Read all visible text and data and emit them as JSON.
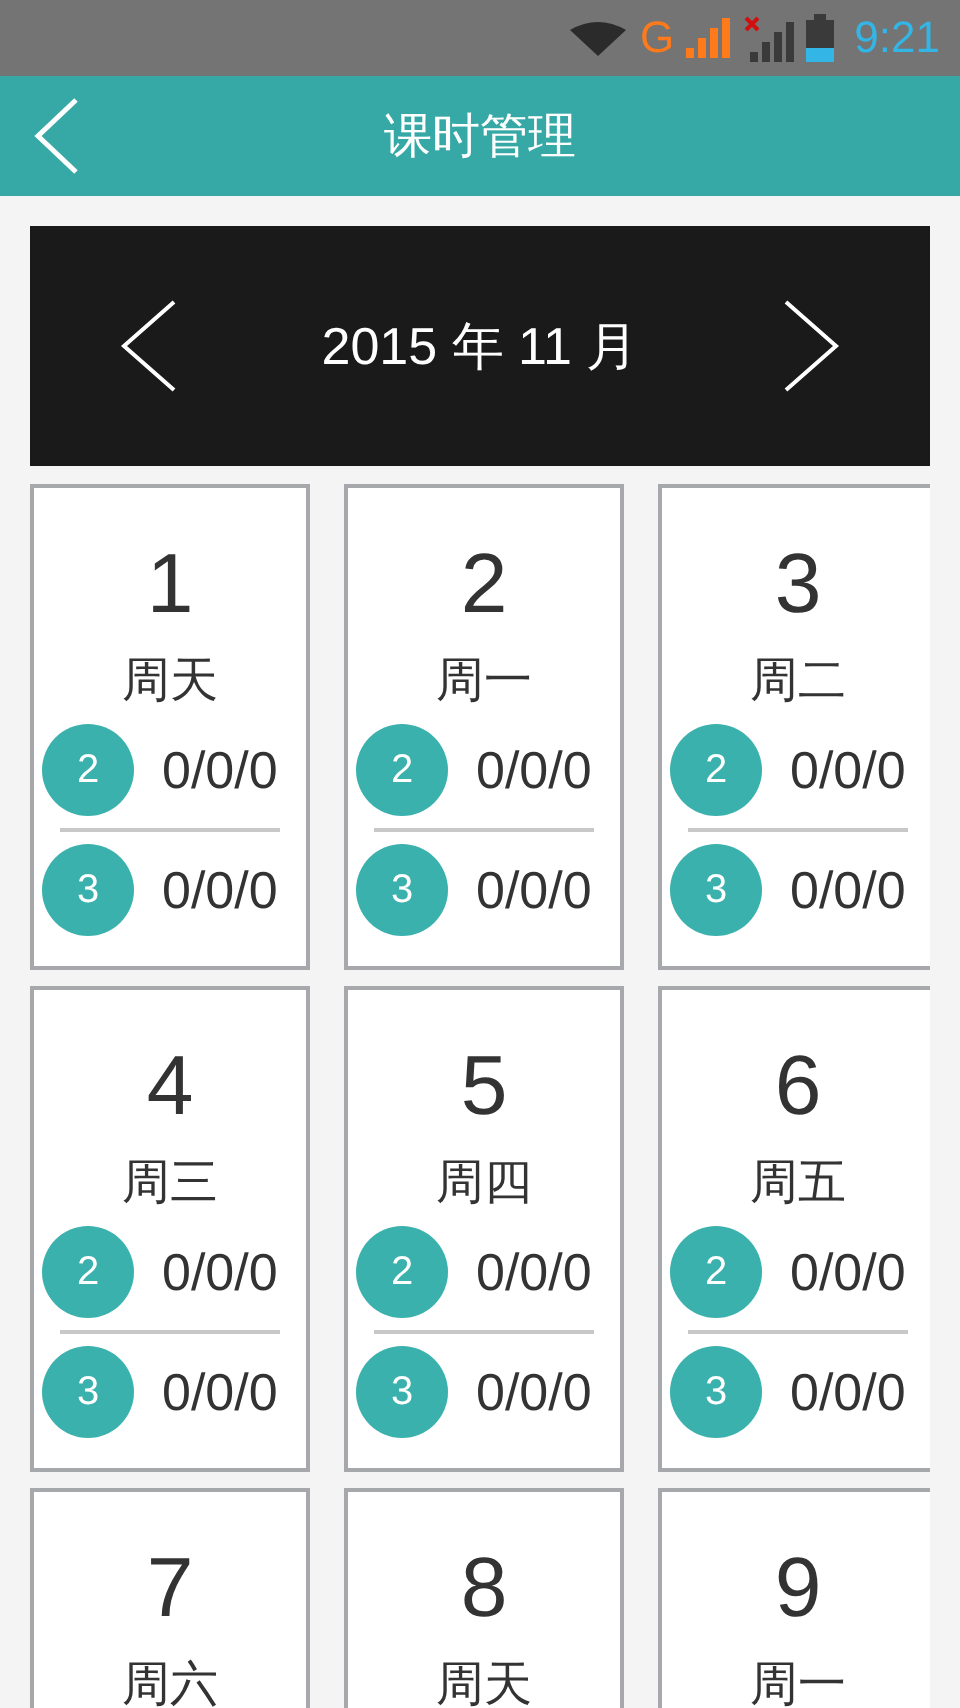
{
  "status_bar": {
    "network": "G",
    "time": "9:21"
  },
  "header": {
    "title": "课时管理"
  },
  "month_nav": {
    "title": "2015 年 11 月"
  },
  "days": [
    {
      "day": "1",
      "weekday": "周天",
      "rows": [
        {
          "badge": "2",
          "value": "0/0/0"
        },
        {
          "badge": "3",
          "value": "0/0/0"
        }
      ]
    },
    {
      "day": "2",
      "weekday": "周一",
      "rows": [
        {
          "badge": "2",
          "value": "0/0/0"
        },
        {
          "badge": "3",
          "value": "0/0/0"
        }
      ]
    },
    {
      "day": "3",
      "weekday": "周二",
      "rows": [
        {
          "badge": "2",
          "value": "0/0/0"
        },
        {
          "badge": "3",
          "value": "0/0/0"
        }
      ]
    },
    {
      "day": "4",
      "weekday": "周三",
      "rows": [
        {
          "badge": "2",
          "value": "0/0/0"
        },
        {
          "badge": "3",
          "value": "0/0/0"
        }
      ]
    },
    {
      "day": "5",
      "weekday": "周四",
      "rows": [
        {
          "badge": "2",
          "value": "0/0/0"
        },
        {
          "badge": "3",
          "value": "0/0/0"
        }
      ]
    },
    {
      "day": "6",
      "weekday": "周五",
      "rows": [
        {
          "badge": "2",
          "value": "0/0/0"
        },
        {
          "badge": "3",
          "value": "0/0/0"
        }
      ]
    },
    {
      "day": "7",
      "weekday": "周六"
    },
    {
      "day": "8",
      "weekday": "周天"
    },
    {
      "day": "9",
      "weekday": "周一"
    }
  ]
}
